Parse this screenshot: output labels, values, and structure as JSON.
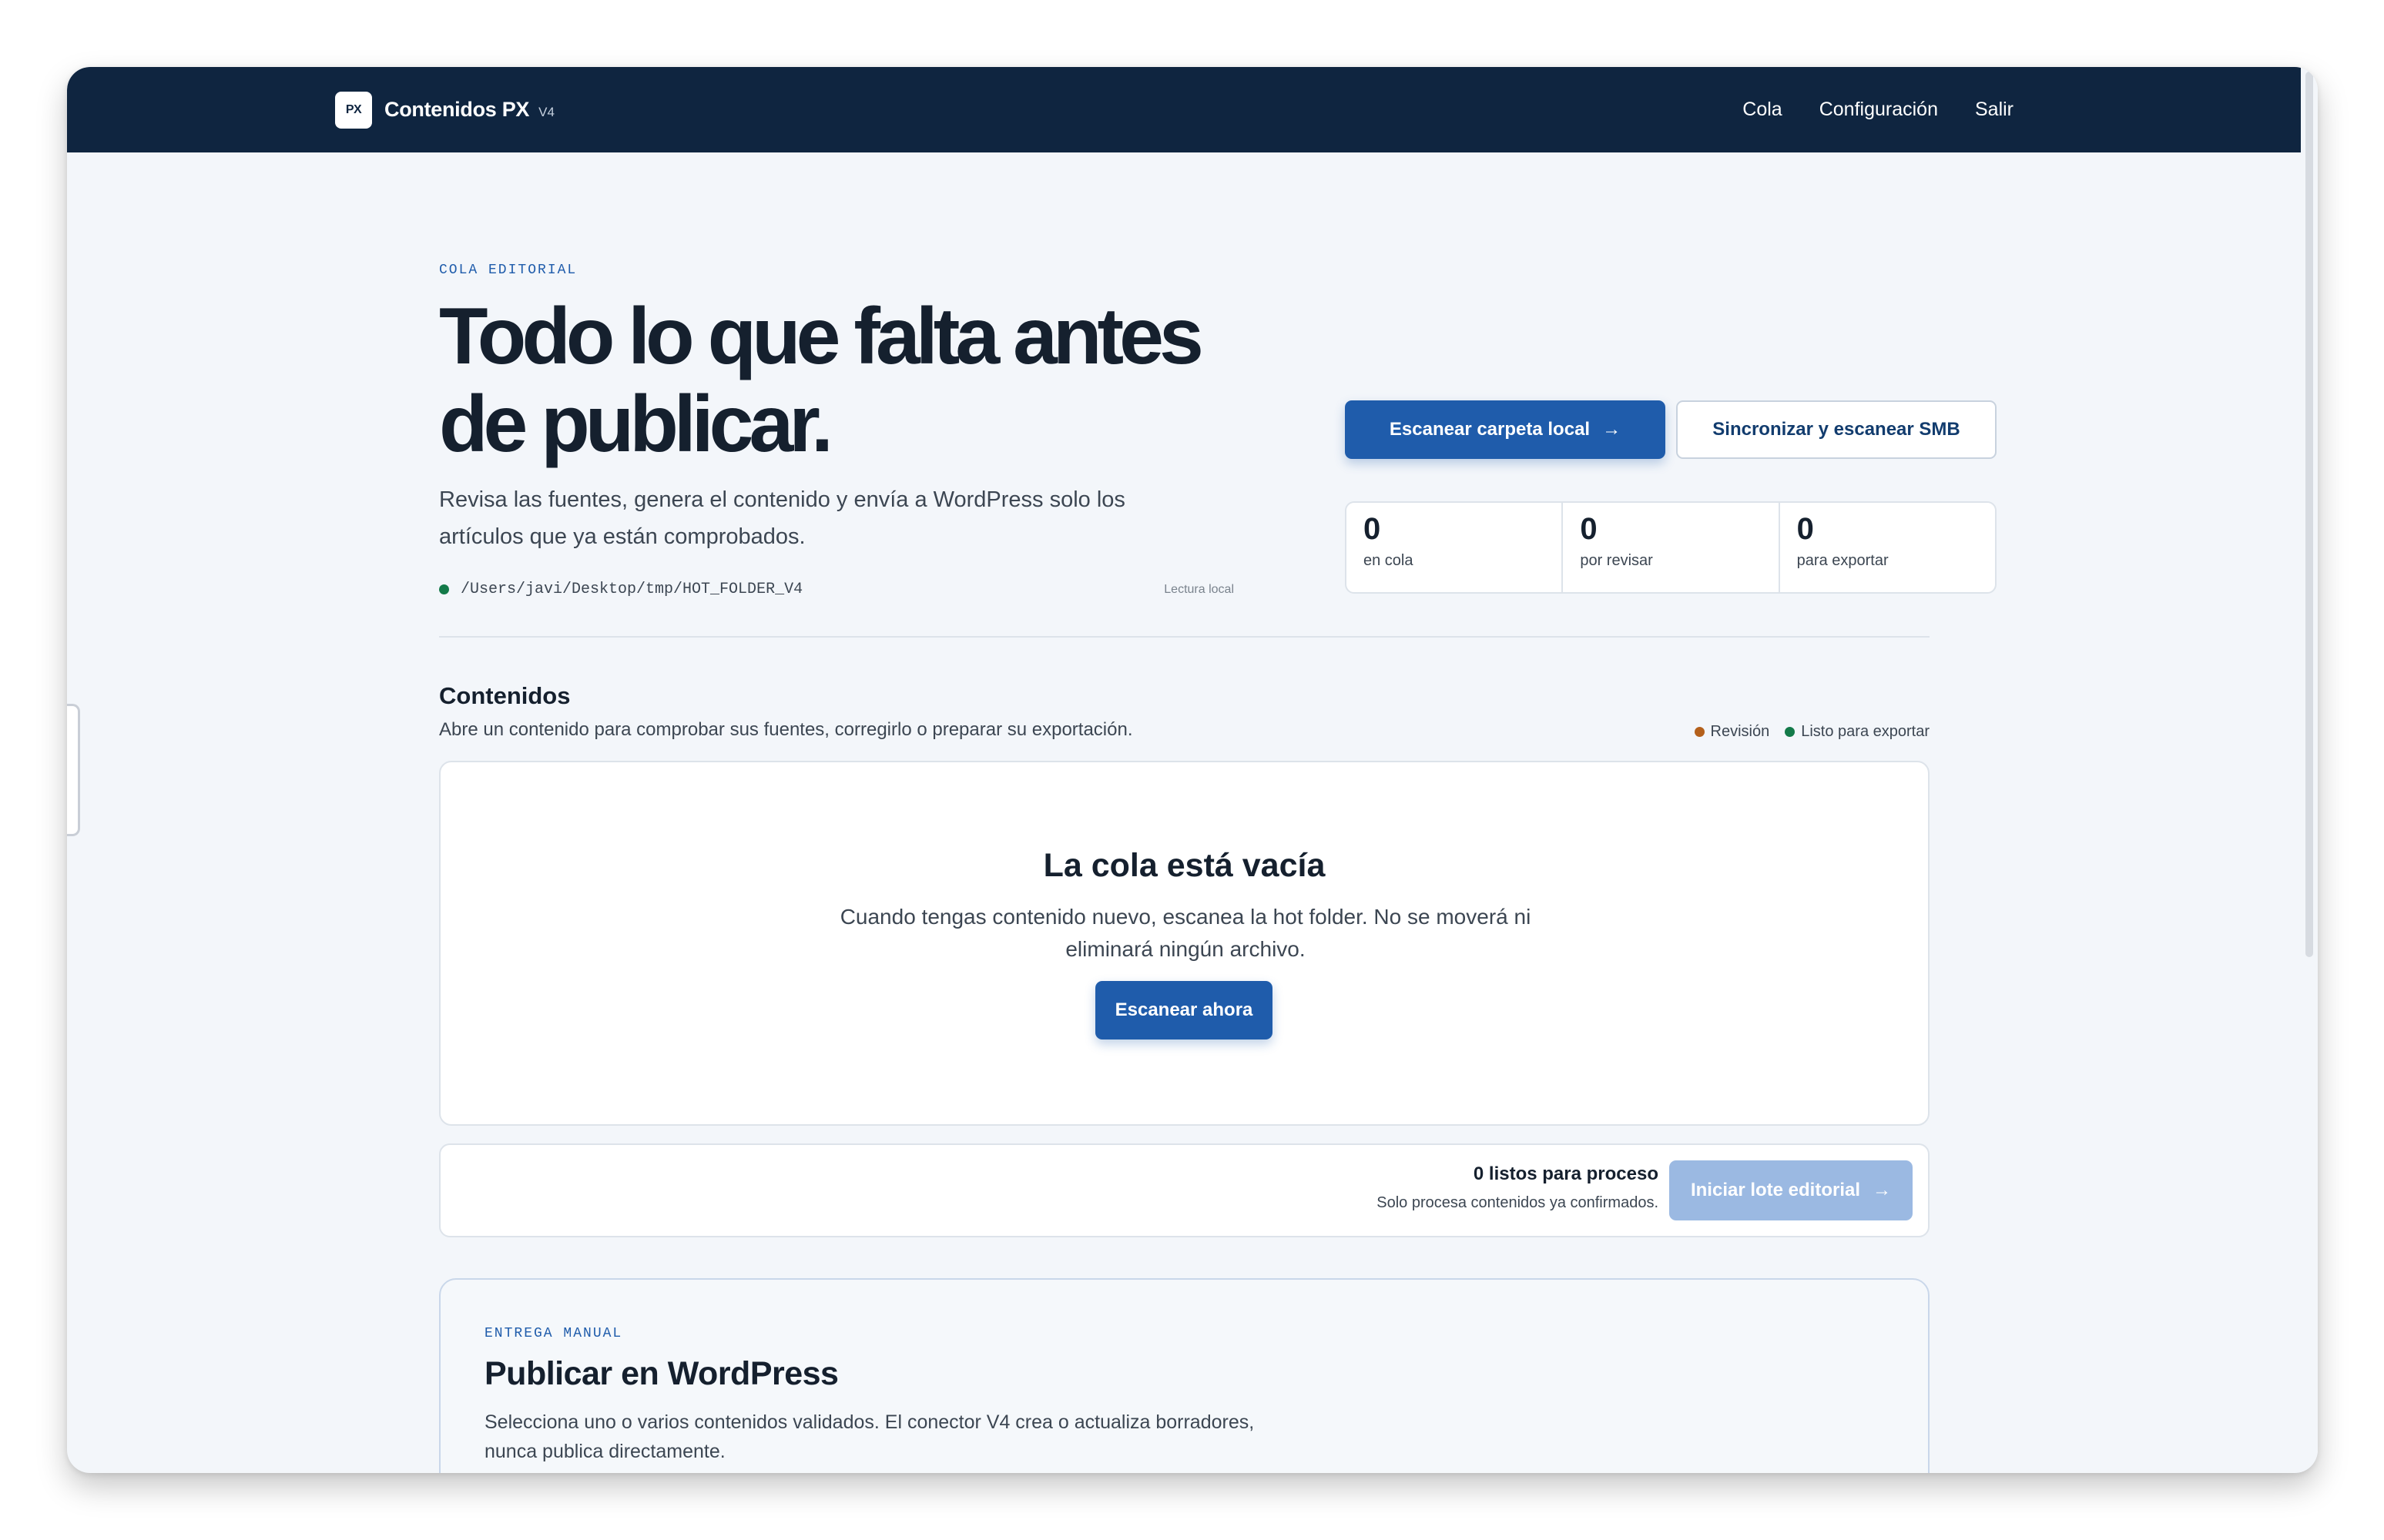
{
  "topbar": {
    "logo_mark": "PX",
    "app_name": "Contenidos PX",
    "version": "V4",
    "nav": [
      "Cola",
      "Configuración",
      "Salir"
    ]
  },
  "hero": {
    "eyebrow": "COLA EDITORIAL",
    "title": "Todo lo que falta antes de publicar.",
    "lead": "Revisa las fuentes, genera el contenido y envía a WordPress solo los artículos que ya están comprobados.",
    "path": "/Users/javi/Desktop/tmp/HOT_FOLDER_V4",
    "path_tag": "Lectura local"
  },
  "actions": {
    "scan_local": "Escanear carpeta local",
    "sync_smb": "Sincronizar y escanear SMB"
  },
  "stats": [
    {
      "value": "0",
      "label": "en cola"
    },
    {
      "value": "0",
      "label": "por revisar"
    },
    {
      "value": "0",
      "label": "para exportar"
    }
  ],
  "contents": {
    "title": "Contenidos",
    "subtitle": "Abre un contenido para comprobar sus fuentes, corregirlo o preparar su exportación.",
    "legend": [
      {
        "label": "Revisión",
        "color": "#b4601b"
      },
      {
        "label": "Listo para exportar",
        "color": "#137a49"
      }
    ],
    "empty_title": "La cola está vacía",
    "empty_text": "Cuando tengas contenido nuevo, escanea la hot folder. No se moverá ni eliminará ningún archivo.",
    "empty_button": "Escanear ahora"
  },
  "batch": {
    "title": "0 listos para proceso",
    "subtitle": "Solo procesa contenidos ya confirmados.",
    "button": "Iniciar lote editorial"
  },
  "wordpress": {
    "eyebrow": "ENTREGA MANUAL",
    "title": "Publicar en WordPress",
    "text": "Selecciona uno o varios contenidos validados. El conector V4 crea o actualiza borradores, nunca publica directamente."
  },
  "colors": {
    "topbar": "#0f2540",
    "accent": "#1f5cab",
    "accent_disabled": "#9bb9e2",
    "background": "#f3f6fa"
  }
}
